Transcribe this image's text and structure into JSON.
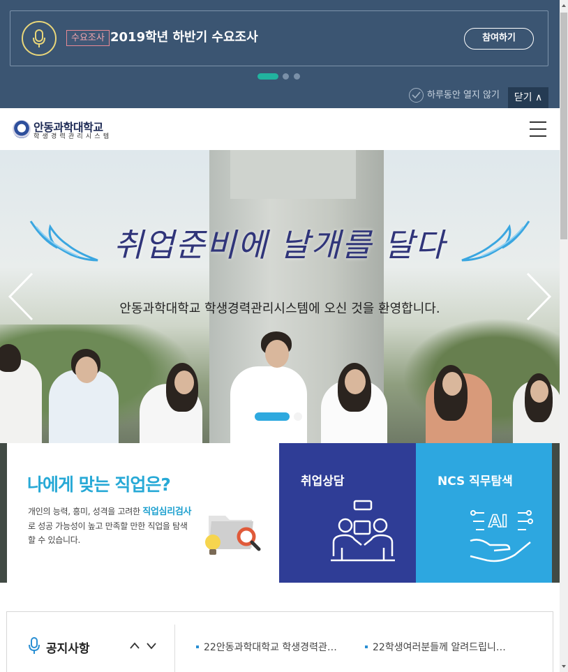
{
  "popup": {
    "tag": "수요조사",
    "title": "2019학년 하반기 수요조사",
    "join_label": "참여하기",
    "dots": [
      "active",
      "inactive",
      "inactive"
    ],
    "dont_show_today": "하루동안 열지 않기",
    "close_label": "닫기 ∧"
  },
  "header": {
    "logo_name": "안동과학대학교",
    "logo_sub": "학생경력관리시스템",
    "menu_icon": "hamburger-icon"
  },
  "hero": {
    "headline": "취업준비에 날개를 달다",
    "subtitle": "안동과학대학교 학생경력관리시스템에 오신 것을 환영합니다.",
    "slides_total": 2,
    "active_slide": 1,
    "prev_icon": "chevron-left-icon",
    "next_icon": "chevron-right-icon"
  },
  "cards": {
    "career": {
      "title": "나에게 맞는 직업은?",
      "desc_pre": "개인의 능력, 흥미, 성격을 고려한 ",
      "desc_bold": "직업심리검사",
      "desc_post": "로 성공 가능성이 높고 만족할 만한 직업을 탐색할 수 있습니다."
    },
    "services": [
      {
        "label": "취업상담",
        "icon": "counseling-icon",
        "color": "#2f3d96"
      },
      {
        "label": "NCS 직무탐색",
        "icon": "ai-hand-icon",
        "color": "#2da7e0"
      }
    ]
  },
  "notice": {
    "title": "공지사항",
    "items": [
      "22안동과학대학교 학생경력관…",
      "22학생여러분들께 알려드립니…"
    ]
  },
  "colors": {
    "popup_bg": "#3b5572",
    "accent_teal": "#21b39f",
    "career_blue": "#27a9d6"
  }
}
